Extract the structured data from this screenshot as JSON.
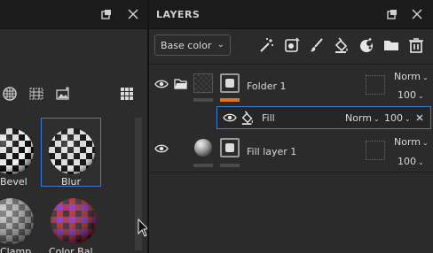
{
  "left_panel": {
    "thumbnails": [
      {
        "label": "Bevel"
      },
      {
        "label": "Blur"
      },
      {
        "label": "Clamp"
      },
      {
        "label": "Color Bal..."
      }
    ]
  },
  "layers_panel": {
    "title": "LAYERS",
    "blend_mode": "Base color",
    "layers": [
      {
        "name": "Folder 1",
        "blend": "Norm",
        "opacity": "100"
      },
      {
        "name": "Fill",
        "blend": "Norm",
        "opacity": "100"
      },
      {
        "name": "Fill layer 1",
        "blend": "Norm",
        "opacity": "100"
      }
    ]
  },
  "colors": {
    "accent": "#3a7bd5",
    "orange": "#e0741f"
  }
}
